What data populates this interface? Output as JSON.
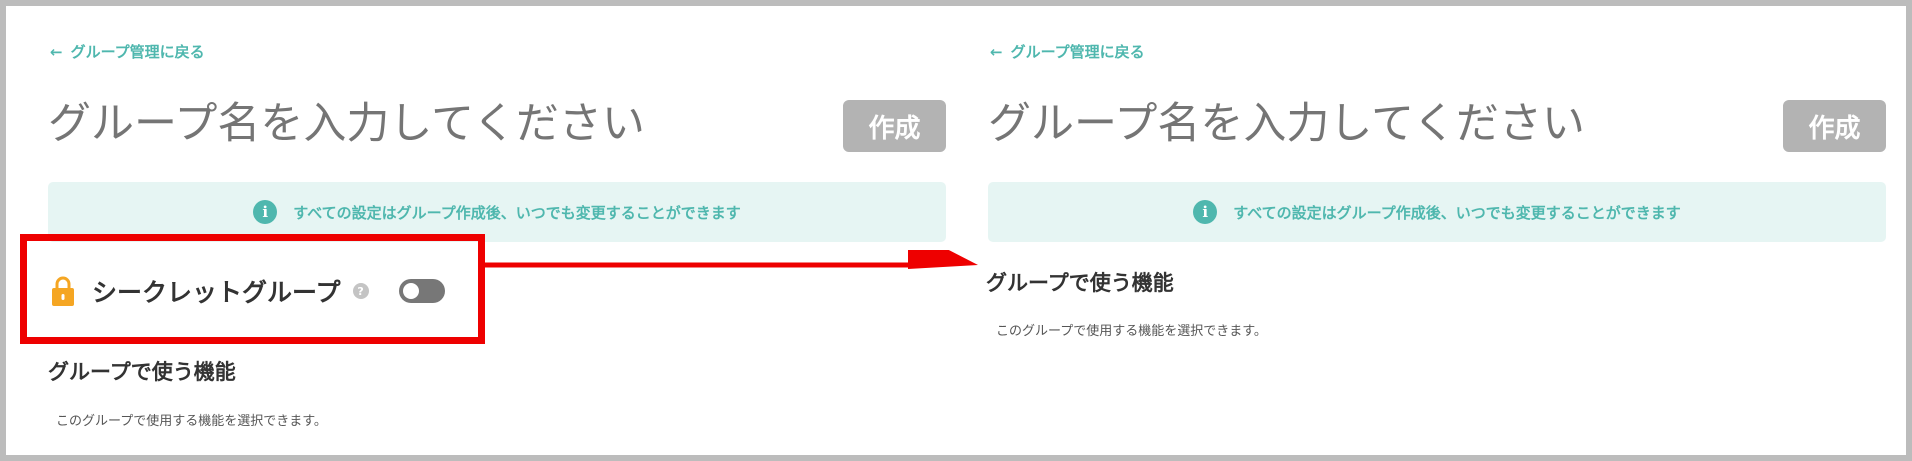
{
  "colors": {
    "accent": "#4fb7ae",
    "info_bg": "#e6f5f3",
    "button_disabled": "#b3b3b3",
    "annotation": "#ee0000",
    "lock": "#f5a623"
  },
  "left_panel": {
    "back_link": "グループ管理に戻る",
    "name_placeholder": "グループ名を入力してください",
    "create_button": "作成",
    "info_text": "すべての設定はグループ作成後、いつでも変更することができます",
    "secret_group_label": "シークレットグループ",
    "secret_toggle_on": false,
    "section_title": "グループで使う機能",
    "section_desc": "このグループで使用する機能を選択できます。"
  },
  "right_panel": {
    "back_link": "グループ管理に戻る",
    "name_placeholder": "グループ名を入力してください",
    "create_button": "作成",
    "info_text": "すべての設定はグループ作成後、いつでも変更することができます",
    "section_title": "グループで使う機能",
    "section_desc": "このグループで使用する機能を選択できます。"
  },
  "icons": {
    "back": "left-arrow-icon",
    "info": "info-icon",
    "lock": "lock-icon",
    "help": "help-icon",
    "annotation_arrow": "arrow-right-icon"
  }
}
